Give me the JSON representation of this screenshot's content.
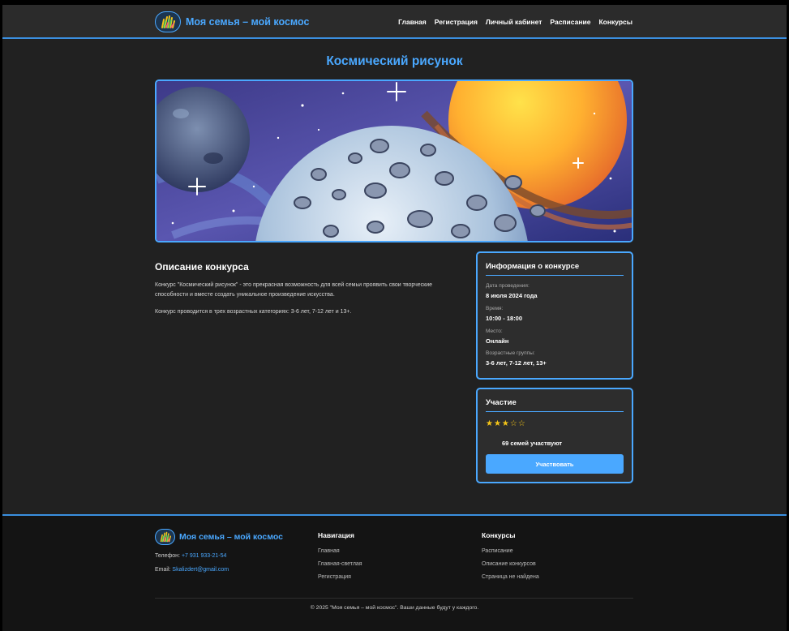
{
  "header": {
    "brand": "Моя семья – мой космос",
    "nav": [
      "Главная",
      "Регистрация",
      "Личный кабинет",
      "Расписание",
      "Конкурсы"
    ]
  },
  "page": {
    "title": "Космический рисунок"
  },
  "description": {
    "heading": "Описание конкурса",
    "p1": "Конкурс \"Космический рисунок\" - это прекрасная возможность для всей семьи проявить свои творческие способности и вместе создать уникальное произведение искусства.",
    "p2": "Конкурс проводится в трех возрастных категориях: 3-6 лет, 7-12 лет и 13+."
  },
  "info_card": {
    "title": "Информация о конкурсе",
    "items": [
      {
        "label": "Дата проведения:",
        "value": "8 июля 2024 года"
      },
      {
        "label": "Время:",
        "value": "10:00 - 18:00"
      },
      {
        "label": "Место:",
        "value": "Онлайн"
      },
      {
        "label": "Возрастные группы:",
        "value": "3-6 лет, 7-12 лет, 13+"
      }
    ]
  },
  "participation": {
    "title": "Участие",
    "rating": 3,
    "rating_max": 5,
    "stars_text": "★★★☆☆",
    "count_text": "69 семей участвуют",
    "button": "Участвовать"
  },
  "footer": {
    "brand": "Моя семья – мой космос",
    "phone_label": "Телефон: ",
    "phone": "+7 931 933-21-54",
    "email_label": "Email: ",
    "email": "Skalizdert@gmail.com",
    "nav_title": "Навигация",
    "nav_links": [
      "Главная",
      "Главная-светлая",
      "Регистрация"
    ],
    "contests_title": "Конкурсы",
    "contests_links": [
      "Расписание",
      "Описание конкурсов",
      "Страница не найдена"
    ],
    "copyright": "© 2025 \"Моя семья – мой космос\". Ваши данные будут у каждого."
  },
  "colors": {
    "accent": "#4aa8ff",
    "background": "#212121",
    "card": "#2d2d2d",
    "star": "#f5c518"
  }
}
